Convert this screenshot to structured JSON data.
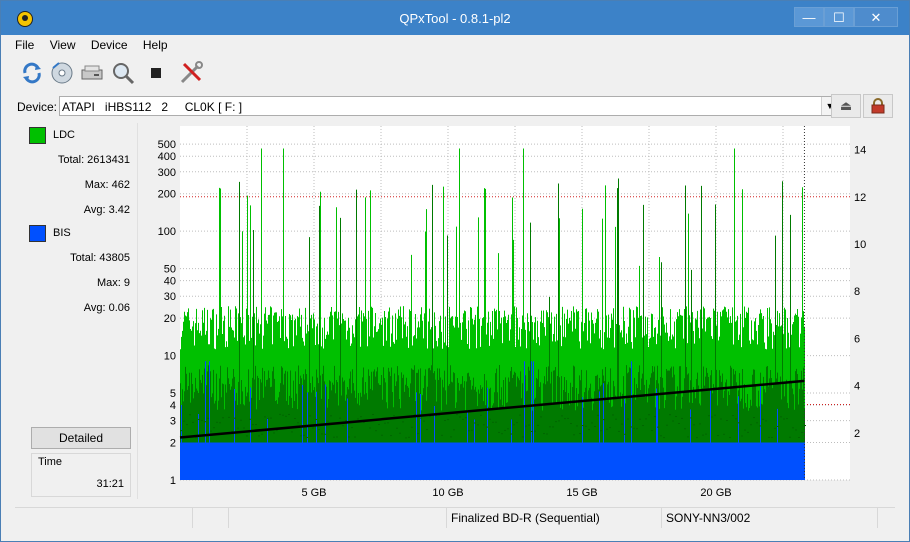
{
  "window": {
    "title": "QPxTool - 0.8.1-pl2",
    "controls": [
      "—",
      "☐",
      "✕"
    ]
  },
  "menu": {
    "items": [
      "File",
      "View",
      "Device",
      "Help"
    ]
  },
  "device": {
    "label": "Device:",
    "value": "ATAPI   iHBS112   2     CL0K [ F: ]"
  },
  "legend": {
    "ldc": {
      "name": "LDC",
      "color": "#00c000",
      "total": "Total: 2613431",
      "max": "Max: 462",
      "avg": "Avg: 3.42"
    },
    "bis": {
      "name": "BIS",
      "color": "#0050ff",
      "total": "Total: 43805",
      "max": "Max: 9",
      "avg": "Avg: 0.06"
    }
  },
  "buttons": {
    "detailed": "Detailed"
  },
  "time": {
    "label": "Time",
    "value": "31:21"
  },
  "status": {
    "disc_type": "Finalized BD-R (Sequential)",
    "media_id": "SONY-NN3/002"
  },
  "chart_data": {
    "type": "area",
    "x_unit": "GB",
    "x_range": [
      0,
      25
    ],
    "x_ticks": [
      "5 GB",
      "10 GB",
      "15 GB",
      "20 GB"
    ],
    "x_tick_values": [
      5,
      10,
      15,
      20
    ],
    "y_left_scale": "log",
    "y_left_range": [
      1,
      700
    ],
    "y_left_ticks": [
      "1",
      "2",
      "3",
      "4",
      "5",
      "10",
      "20",
      "30",
      "40",
      "50",
      "100",
      "200",
      "300",
      "400",
      "500"
    ],
    "y_left_tick_values": [
      1,
      2,
      3,
      4,
      5,
      10,
      20,
      30,
      40,
      50,
      100,
      200,
      300,
      400,
      500
    ],
    "y_right_range": [
      0,
      15
    ],
    "y_right_ticks": [
      "2",
      "4",
      "6",
      "8",
      "10",
      "12",
      "14"
    ],
    "y_right_tick_values": [
      2,
      4,
      6,
      8,
      10,
      12,
      14
    ],
    "data_end_gb": 23.3,
    "grid": true,
    "series": [
      {
        "name": "LDC",
        "color": "#00c000",
        "typical_max": 25,
        "typical_avg": 6,
        "peak": 462
      },
      {
        "name": "BIS",
        "color": "#0050ff",
        "typical": 2,
        "peak": 9
      },
      {
        "name": "Speed",
        "color": "#000000",
        "x": [
          0,
          23.3
        ],
        "y": [
          1.8,
          4.2
        ]
      }
    ],
    "reference_lines_right": [
      3.2,
      12.0
    ]
  }
}
